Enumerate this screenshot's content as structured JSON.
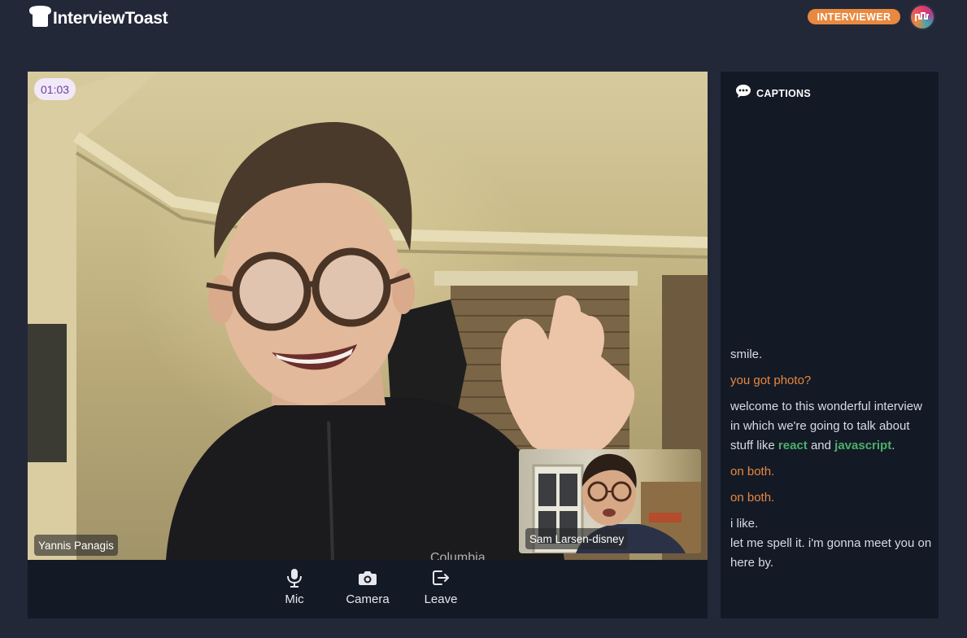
{
  "header": {
    "app_name": "InterviewToast",
    "role_badge": "INTERVIEWER"
  },
  "call": {
    "timer": "01:03",
    "remote_participant": "Yannis Panagis",
    "local_participant": "Sam Larsen-disney"
  },
  "controls": [
    {
      "label": "Mic",
      "icon": "mic-icon"
    },
    {
      "label": "Camera",
      "icon": "camera-icon"
    },
    {
      "label": "Leave",
      "icon": "leave-icon"
    }
  ],
  "captions": {
    "title": "CAPTIONS",
    "lines": [
      {
        "speaker": "local",
        "text": "smile."
      },
      {
        "speaker": "remote",
        "text": "you got photo?"
      },
      {
        "speaker": "local",
        "parts": [
          "welcome to this wonderful interview in which we're going to talk about stuff like ",
          "react",
          " and ",
          "javascript",
          "."
        ]
      },
      {
        "speaker": "remote",
        "text": "on both."
      },
      {
        "speaker": "remote",
        "text": "on both."
      },
      {
        "speaker": "local",
        "text": "i like."
      },
      {
        "speaker": "local",
        "text": "let me spell it. i'm gonna meet you on here by."
      }
    ]
  },
  "colors": {
    "background": "#232838",
    "panel": "#141926",
    "accent_orange": "#e8893f",
    "keyword_green": "#4caf6a",
    "timer_text": "#6b3fa0"
  }
}
